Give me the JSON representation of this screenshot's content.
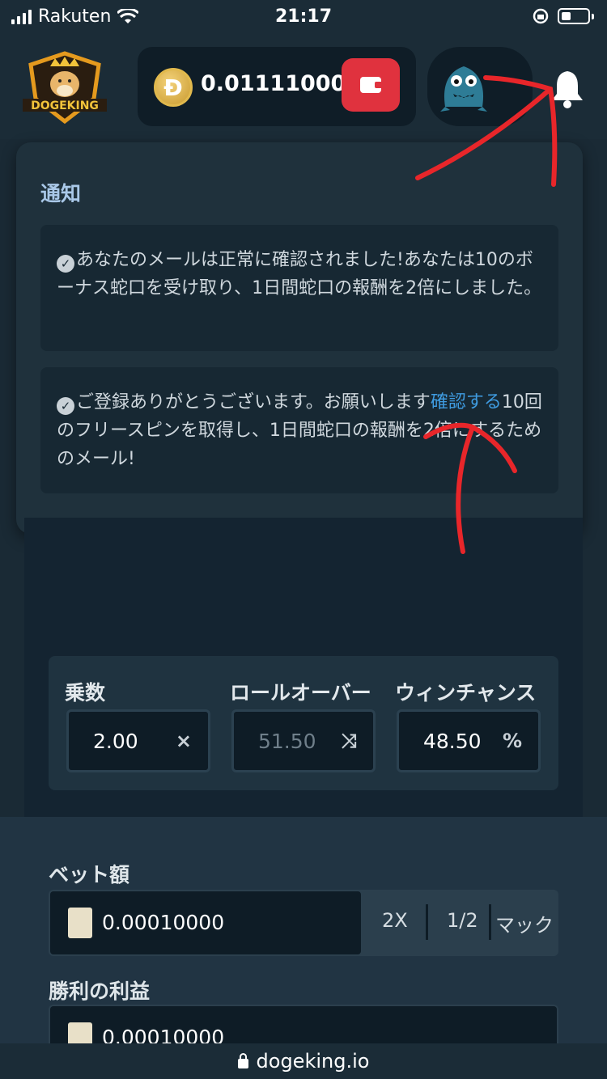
{
  "status_bar": {
    "carrier": "Rakuten",
    "time": "21:17"
  },
  "header": {
    "logo_text": "DOGEKING",
    "balance": "0.01111000",
    "coin_icon": "dogecoin-icon",
    "wallet_icon": "wallet-icon",
    "bell_icon": "bell-icon"
  },
  "notifications": {
    "title": "通知",
    "items": [
      {
        "text": "あなたのメールは正常に確認されました!あなたは10のボーナス蛇口を受け取り、1日間蛇口の報酬を2倍にしました。"
      },
      {
        "text_before": "ご登録ありがとうございます。お願いします",
        "link": "確認する",
        "text_after": "10回のフリースピンを取得し、1日間蛇口の報酬を2倍にするためのメール!"
      }
    ]
  },
  "stats": {
    "multiplier": {
      "label": "乗数",
      "value": "2.00",
      "icon": "×"
    },
    "rollover": {
      "label": "ロールオーバー",
      "value": "51.50",
      "icon": "⤨"
    },
    "win_chance": {
      "label": "ウィンチャンス",
      "value": "48.50",
      "icon": "%"
    }
  },
  "bet": {
    "label": "ベット額",
    "value": "0.00010000",
    "double": "2X",
    "half": "1/2",
    "max": "マック"
  },
  "profit": {
    "label": "勝利の利益",
    "value": "0.00010000"
  },
  "url": "dogeking.io",
  "colors": {
    "accent_red": "#e0323e",
    "link_blue": "#3f9be0",
    "annotation_red": "#e8262a"
  }
}
